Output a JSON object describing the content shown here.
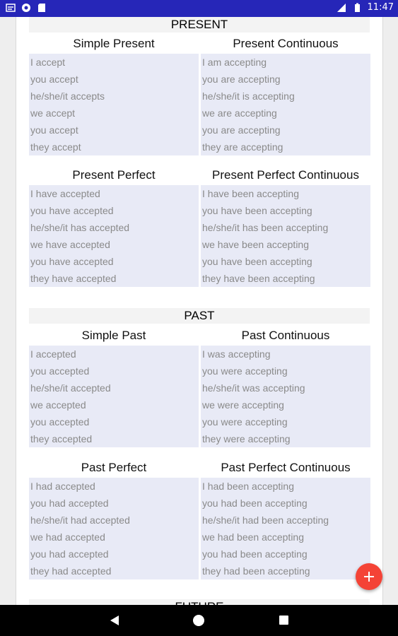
{
  "status_bar": {
    "time": "11:47"
  },
  "sections": [
    {
      "title": "PRESENT",
      "tenses": [
        {
          "name": "Simple Present",
          "forms": [
            "I accept",
            "you accept",
            "he/she/it accepts",
            "we accept",
            "you accept",
            "they accept"
          ]
        },
        {
          "name": "Present Continuous",
          "forms": [
            "I am accepting",
            "you are accepting",
            "he/she/it is accepting",
            "we are accepting",
            "you are accepting",
            "they are accepting"
          ]
        },
        {
          "name": "Present Perfect",
          "forms": [
            "I have accepted",
            "you have accepted",
            "he/she/it has accepted",
            "we have accepted",
            "you have accepted",
            "they have accepted"
          ]
        },
        {
          "name": "Present Perfect Continuous",
          "forms": [
            "I have been accepting",
            "you have been accepting",
            "he/she/it has been accepting",
            "we have been accepting",
            "you have been accepting",
            "they have been accepting"
          ]
        }
      ]
    },
    {
      "title": "PAST",
      "tenses": [
        {
          "name": "Simple Past",
          "forms": [
            "I accepted",
            "you accepted",
            "he/she/it accepted",
            "we accepted",
            "you accepted",
            "they accepted"
          ]
        },
        {
          "name": "Past Continuous",
          "forms": [
            "I was accepting",
            "you were accepting",
            "he/she/it was accepting",
            "we were accepting",
            "you were accepting",
            "they were accepting"
          ]
        },
        {
          "name": "Past Perfect",
          "forms": [
            "I had accepted",
            "you had accepted",
            "he/she/it had accepted",
            "we had accepted",
            "you had accepted",
            "they had accepted"
          ]
        },
        {
          "name": "Past Perfect Continuous",
          "forms": [
            "I had been accepting",
            "you had been accepting",
            "he/she/it had been accepting",
            "we had been accepting",
            "you had been accepting",
            "they had been accepting"
          ]
        }
      ]
    },
    {
      "title": "FUTURE",
      "tenses": []
    }
  ],
  "fab": {
    "icon": "plus-icon",
    "color": "#f44336"
  },
  "colors": {
    "status_bar": "#2626b8",
    "conjugation_bg": "#e8eaf6",
    "header_bg": "#f3f3f3"
  }
}
